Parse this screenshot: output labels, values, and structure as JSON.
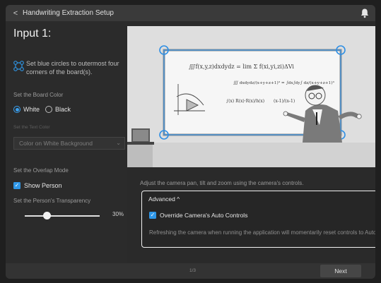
{
  "titlebar": {
    "title": "Handwriting Extraction Setup"
  },
  "left": {
    "heading": "Input 1:",
    "corner_hint": "Set blue circles to outermost four corners of the board(s).",
    "board_color_label": "Set the Board Color",
    "board_color_options": [
      "White",
      "Black"
    ],
    "board_color_selected": "White",
    "text_color_label": "Set the Text Color",
    "text_color_value": "Color on White Background",
    "overlap_label": "Set the Overlap Mode",
    "show_person_label": "Show Person",
    "show_person_checked": true,
    "transparency_label": "Set the Person's Transparency",
    "transparency_value": "30%",
    "transparency_level": 0.3
  },
  "main": {
    "camera_hint": "Adjust the camera pan, tilt and zoom using the camera's controls.",
    "advanced": {
      "header": "Advanced ^",
      "override_label": "Override Camera's Auto Controls",
      "override_checked": true,
      "note": "Refreshing the camera when running the application will momentarily reset controls to Auto."
    },
    "board_text": {
      "line1": "∭f(x,y,z)dxdydz = lim Σ f(xi,yi,zi)ΔVi",
      "line2": "∭ dxdydz/(x+y+z+1)³ = ∫dx∫dy∫ dz/(x+y+z+1)³",
      "line3": "∫(x) R(x)·R(x)/h(x)",
      "line4": "(x-1)/(n-1)"
    }
  },
  "footer": {
    "page": "1/3",
    "next_label": "Next"
  },
  "colors": {
    "accent": "#2f97e8",
    "corner_handle": "#2f8fe4"
  }
}
